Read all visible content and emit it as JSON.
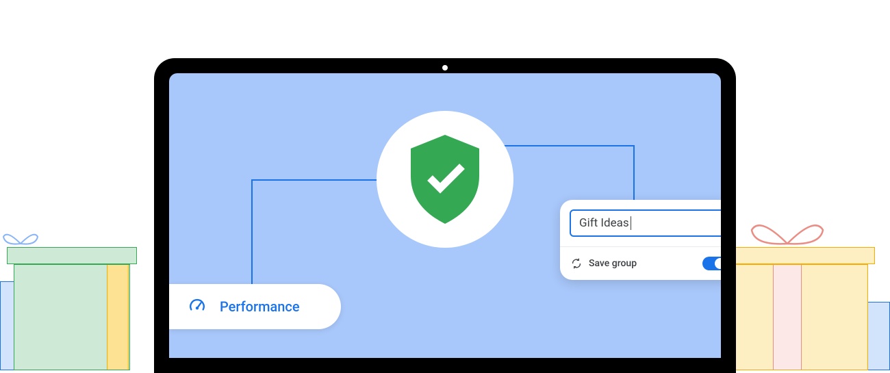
{
  "performance": {
    "label": "Performance"
  },
  "tab_group": {
    "input_value": "Gift Ideas",
    "save_label": "Save group",
    "toggle_on": true
  },
  "icons": {
    "shield": "shield-check-icon",
    "speedometer": "speedometer-icon",
    "sync": "sync-icon"
  },
  "colors": {
    "screen_bg": "#a8c7fa",
    "accent_blue": "#1a73e8",
    "shield_green": "#34a853"
  }
}
